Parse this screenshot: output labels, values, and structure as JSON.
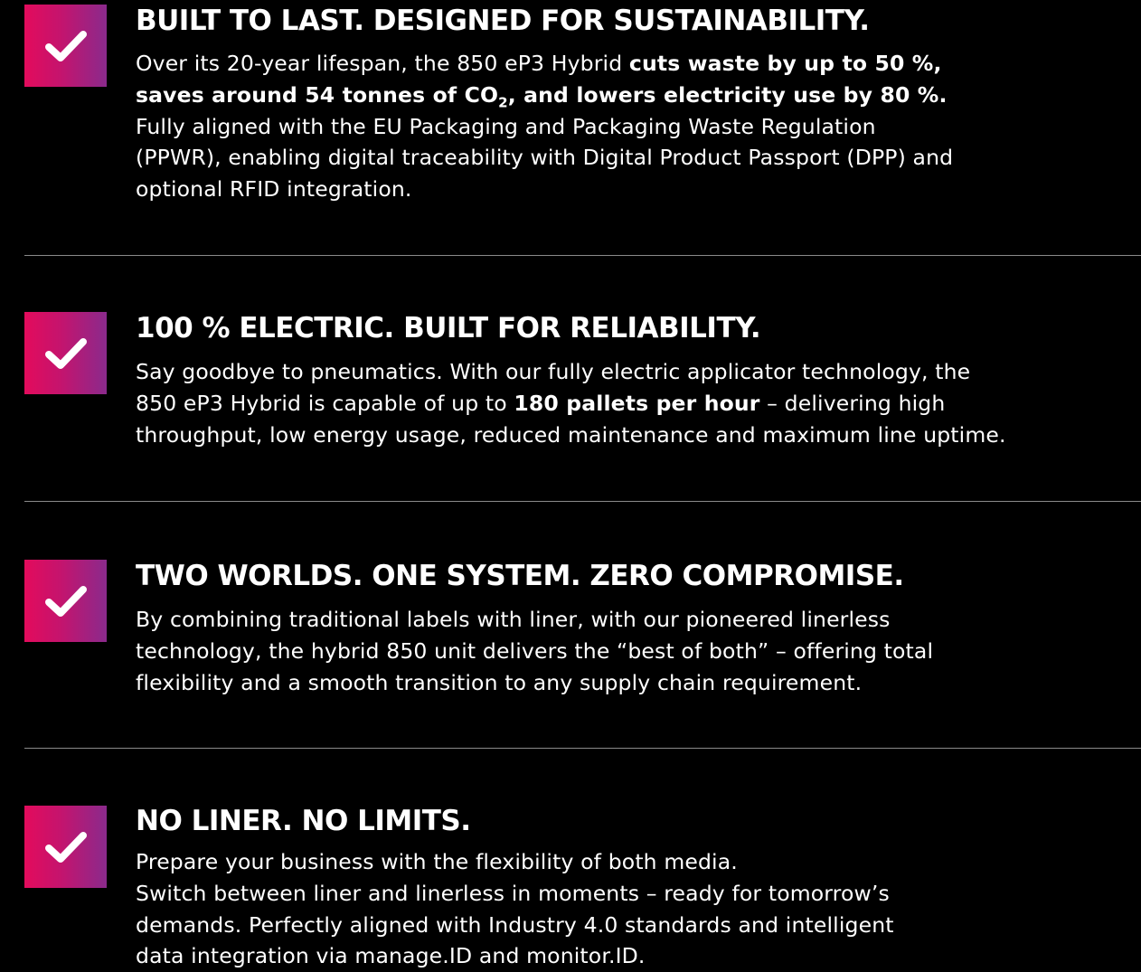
{
  "features": [
    {
      "title": "BUILT TO LAST. DESIGNED FOR SUSTAINABILITY.",
      "line1_normal": "Over its 20-year lifespan, the 850 eP3 Hybrid ",
      "line1_bold": "cuts waste by up to 50 %,",
      "line2_bold_a": "saves around 54 tonnes of CO",
      "line2_sub": "2",
      "line2_bold_b": ", and lowers electricity use by 80 %.",
      "line3": "Fully aligned with the EU Packaging and Packaging Waste Regulation",
      "line4": "(PPWR), enabling digital traceability with Digital Product Passport (DPP) and",
      "line5": "optional RFID integration."
    },
    {
      "title": "100 % ELECTRIC. BUILT FOR RELIABILITY.",
      "line1": "Say goodbye to pneumatics. With our fully electric applicator technology, the",
      "line2_normal_a": "850 eP3 Hybrid is capable of up to ",
      "line2_bold": "180 pallets per hour",
      "line2_normal_b": " – delivering high",
      "line3": "throughput, low energy usage, reduced maintenance and maximum line uptime."
    },
    {
      "title": "TWO WORLDS. ONE SYSTEM. ZERO COMPROMISE.",
      "line1": "By combining traditional labels with liner, with our pioneered linerless",
      "line2": "technology, the hybrid 850 unit delivers the “best of both” – offering total",
      "line3": "flexibility and a smooth transition to any supply chain requirement."
    },
    {
      "title": "NO LINER. NO LIMITS.",
      "line1": "Prepare your business with the flexibility of both media.",
      "line2": "Switch between liner and linerless in moments – ready for tomorrow’s",
      "line3": "demands. Perfectly aligned with Industry 4.0 standards and intelligent",
      "line4": "data integration via manage.ID and monitor.ID."
    }
  ],
  "icons": {
    "check": "checkmark-icon"
  },
  "colors": {
    "background": "#000000",
    "text": "#ffffff",
    "gradient_start": "#e30b5c",
    "gradient_end": "#8a2a8c",
    "divider": "#8a8a8a"
  }
}
